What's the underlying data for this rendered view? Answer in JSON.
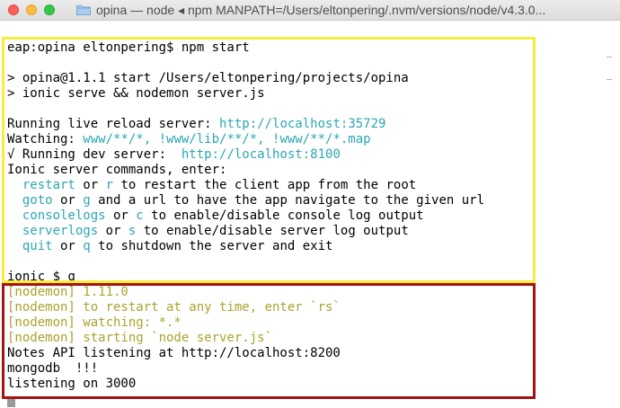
{
  "window": {
    "title": "opina — node ◂ npm MANPATH=/Users/eltonpering/.nvm/versions/node/v4.3.0..."
  },
  "icons": {
    "close": "close-button",
    "minimize": "minimize-button",
    "zoom": "zoom-button",
    "folder": "folder-icon"
  },
  "colors": {
    "output_cyan": "#2aa7b4",
    "nodemon_olive": "#a9a32d",
    "highlight_yellow": "#f6ed3c",
    "highlight_red": "#a31515"
  },
  "terminal": {
    "lines": [
      {
        "segments": [
          {
            "text": "eap:opina eltonpering$ npm start",
            "color": "default"
          }
        ]
      },
      {
        "segments": [
          {
            "text": "",
            "color": "default"
          }
        ]
      },
      {
        "segments": [
          {
            "text": "> opina@1.1.1 start /Users/eltonpering/projects/opina",
            "color": "default"
          }
        ]
      },
      {
        "segments": [
          {
            "text": "> ionic serve && nodemon server.js",
            "color": "default"
          }
        ]
      },
      {
        "segments": [
          {
            "text": "",
            "color": "default"
          }
        ]
      },
      {
        "segments": [
          {
            "text": "Running live reload server: ",
            "color": "default"
          },
          {
            "text": "http://localhost:35729",
            "color": "cyan"
          }
        ]
      },
      {
        "segments": [
          {
            "text": "Watching: ",
            "color": "default"
          },
          {
            "text": "www/**/*, !www/lib/**/*, !www/**/*.map",
            "color": "cyan"
          }
        ]
      },
      {
        "segments": [
          {
            "text": "√ Running dev server:  ",
            "color": "default"
          },
          {
            "text": "http://localhost:8100",
            "color": "cyan"
          }
        ]
      },
      {
        "segments": [
          {
            "text": "Ionic server commands, enter:",
            "color": "default"
          }
        ]
      },
      {
        "segments": [
          {
            "text": "  ",
            "color": "default"
          },
          {
            "text": "restart",
            "color": "cyan"
          },
          {
            "text": " or ",
            "color": "default"
          },
          {
            "text": "r",
            "color": "cyan"
          },
          {
            "text": " to restart the client app from the root",
            "color": "default"
          }
        ]
      },
      {
        "segments": [
          {
            "text": "  ",
            "color": "default"
          },
          {
            "text": "goto",
            "color": "cyan"
          },
          {
            "text": " or ",
            "color": "default"
          },
          {
            "text": "g",
            "color": "cyan"
          },
          {
            "text": " and a url to have the app navigate to the given url",
            "color": "default"
          }
        ]
      },
      {
        "segments": [
          {
            "text": "  ",
            "color": "default"
          },
          {
            "text": "consolelogs",
            "color": "cyan"
          },
          {
            "text": " or ",
            "color": "default"
          },
          {
            "text": "c",
            "color": "cyan"
          },
          {
            "text": " to enable/disable console log output",
            "color": "default"
          }
        ]
      },
      {
        "segments": [
          {
            "text": "  ",
            "color": "default"
          },
          {
            "text": "serverlogs",
            "color": "cyan"
          },
          {
            "text": " or ",
            "color": "default"
          },
          {
            "text": "s",
            "color": "cyan"
          },
          {
            "text": " to enable/disable server log output",
            "color": "default"
          }
        ]
      },
      {
        "segments": [
          {
            "text": "  ",
            "color": "default"
          },
          {
            "text": "quit",
            "color": "cyan"
          },
          {
            "text": " or ",
            "color": "default"
          },
          {
            "text": "q",
            "color": "cyan"
          },
          {
            "text": " to shutdown the server and exit",
            "color": "default"
          }
        ]
      },
      {
        "segments": [
          {
            "text": "",
            "color": "default"
          }
        ]
      },
      {
        "segments": [
          {
            "text": "ionic $ q",
            "color": "default"
          }
        ]
      },
      {
        "segments": [
          {
            "text": "[nodemon] 1.11.0",
            "color": "olive"
          }
        ]
      },
      {
        "segments": [
          {
            "text": "[nodemon] to restart at any time, enter `rs`",
            "color": "olive"
          }
        ]
      },
      {
        "segments": [
          {
            "text": "[nodemon] watching: *.*",
            "color": "olive"
          }
        ]
      },
      {
        "segments": [
          {
            "text": "[nodemon] starting `node server.js`",
            "color": "olive"
          }
        ]
      },
      {
        "segments": [
          {
            "text": "Notes API listening at http://localhost:8200",
            "color": "default"
          }
        ]
      },
      {
        "segments": [
          {
            "text": "mongodb  !!!",
            "color": "default"
          }
        ]
      },
      {
        "segments": [
          {
            "text": "listening on 3000",
            "color": "default"
          }
        ]
      }
    ]
  }
}
